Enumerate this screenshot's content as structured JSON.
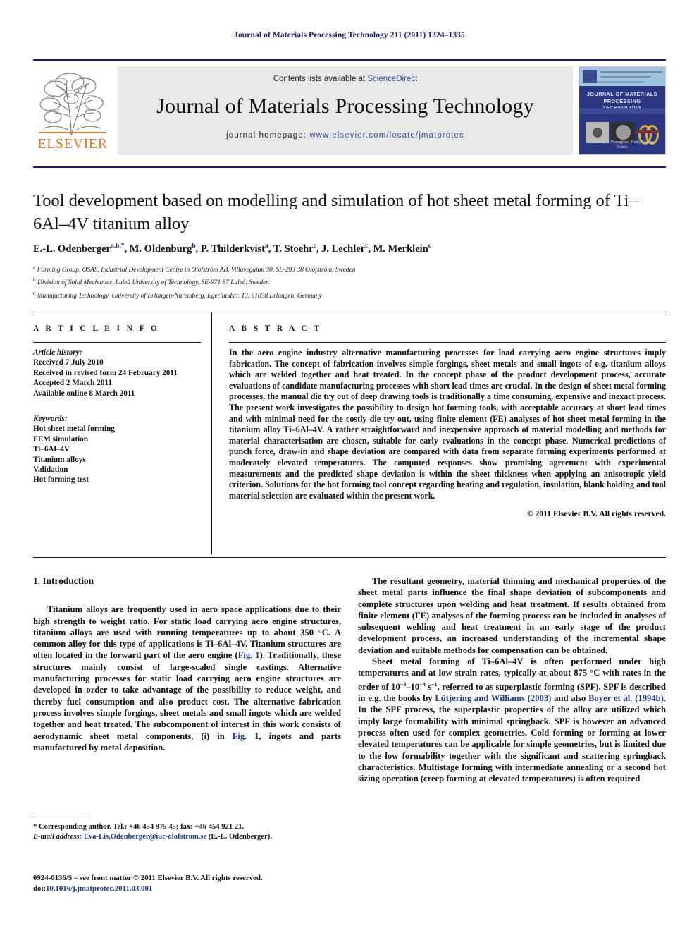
{
  "running_head": "Journal of Materials Processing Technology 211 (2011) 1324–1335",
  "masthead": {
    "contents_prefix": "Contents lists available at ",
    "sciencedirect": "ScienceDirect",
    "journal_name": "Journal of Materials Processing Technology",
    "homepage_label": "journal homepage: ",
    "homepage_url": "www.elsevier.com/locate/jmatprotec",
    "publisher_wordmark": "ELSEVIER",
    "publisher_color": "#e87722",
    "link_color": "#2b4f9e",
    "rule_color": "#1a1a6e"
  },
  "cover": {
    "title_line1": "JOURNAL OF MATERIALS",
    "title_line2": "PROCESSING TECHNOLOGY",
    "footer": "Edited by\nJ. Monaghan, Trinity College Dublin",
    "bg_color": "#2b3580",
    "header_color": "#9fc4e0"
  },
  "article": {
    "title": "Tool development based on modelling and simulation of hot sheet metal forming of Ti–6Al–4V titanium alloy",
    "authors_html": "E.-L. Odenberger<sup>a,b,*</sup>, M. Oldenburg<sup>b</sup>, P. Thilderkvist<sup>a</sup>, T. Stoehr<sup>c</sup>, J. Lechler<sup>c</sup>, M. Merklein<sup>c</sup>",
    "affiliations": [
      {
        "mark": "a",
        "text": "Forming Group, OSAS, Industrial Development Centre in Olofström AB, Villavegatan 30, SE-293 38 Olofström, Sweden"
      },
      {
        "mark": "b",
        "text": "Division of Solid Mechanics, Luleå University of Technology, SE-971 87 Luleå, Sweden"
      },
      {
        "mark": "c",
        "text": "Manufacturing Technology, University of Erlangen-Nuremberg, Egerlandstr. 13, 91058 Erlangen, Germany"
      }
    ]
  },
  "article_info": {
    "heading": "A R T I C L E    I N F O",
    "history_label": "Article history:",
    "history": [
      "Received 7 July 2010",
      "Received in revised form 24 February 2011",
      "Accepted 2 March 2011",
      "Available online 8 March 2011"
    ],
    "keywords_label": "Keywords:",
    "keywords": [
      "Hot sheet metal forming",
      "FEM simulation",
      "Ti–6Al–4V",
      "Titanium alloys",
      "Validation",
      "Hot forming test"
    ]
  },
  "abstract": {
    "heading": "A B S T R A C T",
    "text": "In the aero engine industry alternative manufacturing processes for load carrying aero engine structures imply fabrication. The concept of fabrication involves simple forgings, sheet metals and small ingots of e.g. titanium alloys which are welded together and heat treated. In the concept phase of the product development process, accurate evaluations of candidate manufacturing processes with short lead times are crucial. In the design of sheet metal forming processes, the manual die try out of deep drawing tools is traditionally a time consuming, expensive and inexact process. The present work investigates the possibility to design hot forming tools, with acceptable accuracy at short lead times and with minimal need for the costly die try out, using finite element (FE) analyses of hot sheet metal forming in the titanium alloy Ti–6Al–4V. A rather straightforward and inexpensive approach of material modelling and methods for material characterisation are chosen, suitable for early evaluations in the concept phase. Numerical predictions of punch force, draw-in and shape deviation are compared with data from separate forming experiments performed at moderately elevated temperatures. The computed responses show promising agreement with experimental measurements and the predicted shape deviation is within the sheet thickness when applying an anisotropic yield criterion. Solutions for the hot forming tool concept regarding heating and regulation, insulation, blank holding and tool material selection are evaluated within the present work.",
    "copyright": "© 2011 Elsevier B.V. All rights reserved."
  },
  "body": {
    "section_number_title": "1.  Introduction",
    "left_p1_html": "Titanium alloys are frequently used in aero space applications due to their high strength to weight ratio. For static load carrying aero engine structures, titanium alloys are used with running temperatures up to about 350&nbsp;°C. A common alloy for this type of applications is Ti–6Al–4V. Titanium structures are often located in the forward part of the aero engine (<span class=\"ref\">Fig. 1</span>). Traditionally, these structures mainly consist of large-scaled single castings. Alternative manufacturing processes for static load carrying aero engine structures are developed in order to take advantage of the possibility to reduce weight, and thereby fuel consumption and also product cost. The alternative fabrication process involves simple forgings, sheet metals and small ingots which are welded together and heat treated. The subcomponent of interest in this work consists of aerodynamic sheet metal components, (i) in <span class=\"ref\">Fig. 1</span>, ingots and parts manufactured by metal deposition.",
    "right_p1_html": "The resultant geometry, material thinning and mechanical properties of the sheet metal parts influence the final shape deviation of subcomponents and complete structures upon welding and heat treatment. If results obtained from finite element (FE) analyses of the forming process can be included in analyses of subsequent welding and heat treatment in an early stage of the product development process, an increased understanding of the incremental shape deviation and suitable methods for compensation can be obtained.",
    "right_p2_html": "Sheet metal forming of Ti–6Al–4V is often performed under high temperatures and at low strain rates, typically at about 875&nbsp;°C with rates in the order of 10<sup class=\"sup\">−3</sup>–10<sup class=\"sup\">−4</sup>&nbsp;s<sup class=\"sup\">−1</sup>, referred to as superplastic forming (SPF). SPF is described in e.g. the books by <span class=\"ref\">Lütjering and Williams (2003)</span> and also <span class=\"ref\">Boyer et al. (1994b)</span>. In the SPF process, the superplastic properties of the alloy are utilized which imply large formability with minimal springback. SPF is however an advanced process often used for complex geometries. Cold forming or forming at lower elevated temperatures can be applicable for simple geometries, but is limited due to the low formability together with the significant and scattering springback characteristics. Multistage forming with intermediate annealing or a second hot sizing operation (creep forming at elevated temperatures) is often required"
  },
  "footnotes": {
    "corresponding_html": "* Corresponding author. Tel.: +46 454 975 45; fax: +46 454 921 21.",
    "email_label": "E-mail address:",
    "email": "Eva-Lis.Odenberger@iuc-olofstrom.se",
    "email_suffix": "(E.-L. Odenberger).",
    "issn_line": "0924-0136/$ – see front matter © 2011 Elsevier B.V. All rights reserved.",
    "doi_label": "doi:",
    "doi": "10.1016/j.jmatprotec.2011.03.001"
  }
}
